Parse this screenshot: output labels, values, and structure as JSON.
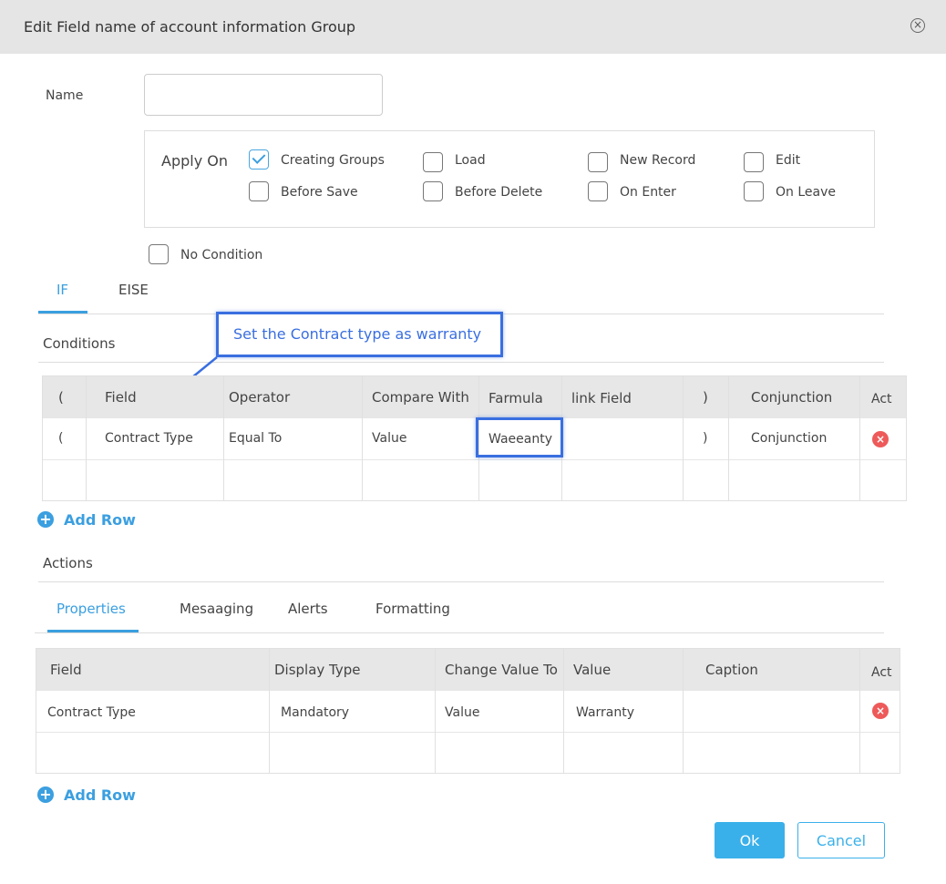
{
  "dialog": {
    "title": "Edit Field name of account information Group"
  },
  "name_field": {
    "label": "Name",
    "value": "",
    "placeholder": ""
  },
  "apply_on": {
    "label": "Apply On",
    "options": [
      {
        "label": "Creating Groups",
        "checked": true
      },
      {
        "label": "Load",
        "checked": false
      },
      {
        "label": "New Record",
        "checked": false
      },
      {
        "label": "Edit",
        "checked": false
      },
      {
        "label": "Before Save",
        "checked": false
      },
      {
        "label": "Before Delete",
        "checked": false
      },
      {
        "label": "On Enter",
        "checked": false
      },
      {
        "label": "On Leave",
        "checked": false
      }
    ]
  },
  "no_condition": {
    "label": "No Condition",
    "checked": false
  },
  "condition_tabs": [
    "IF",
    "EISE"
  ],
  "conditions": {
    "title": "Conditions",
    "headers": [
      "(",
      "Field",
      "Operator",
      "Compare With",
      "Farmula",
      "link Field",
      ")",
      "Conjunction",
      "Act"
    ],
    "rows": [
      [
        "(",
        "Contract Type",
        "Equal To",
        "Value",
        "Waeeanty",
        "",
        ")",
        "Conjunction"
      ]
    ],
    "add_row": "Add Row"
  },
  "annotation": {
    "text": "Set the Contract type as warranty"
  },
  "actions": {
    "title": "Actions",
    "tabs": [
      "Properties",
      "Mesaaging",
      "Alerts",
      "Formatting"
    ],
    "headers": [
      "Field",
      "Display Type",
      "Change Value To",
      "Value",
      "Caption",
      "Act"
    ],
    "rows": [
      [
        "Contract Type",
        "Mandatory",
        "Value",
        "Warranty",
        ""
      ]
    ],
    "add_row": "Add Row"
  },
  "footer": {
    "ok": "Ok",
    "cancel": "Cancel"
  },
  "colors": {
    "accent": "#3b9fe0",
    "annotation": "#3a6fe0",
    "danger": "#ee5a5a"
  }
}
